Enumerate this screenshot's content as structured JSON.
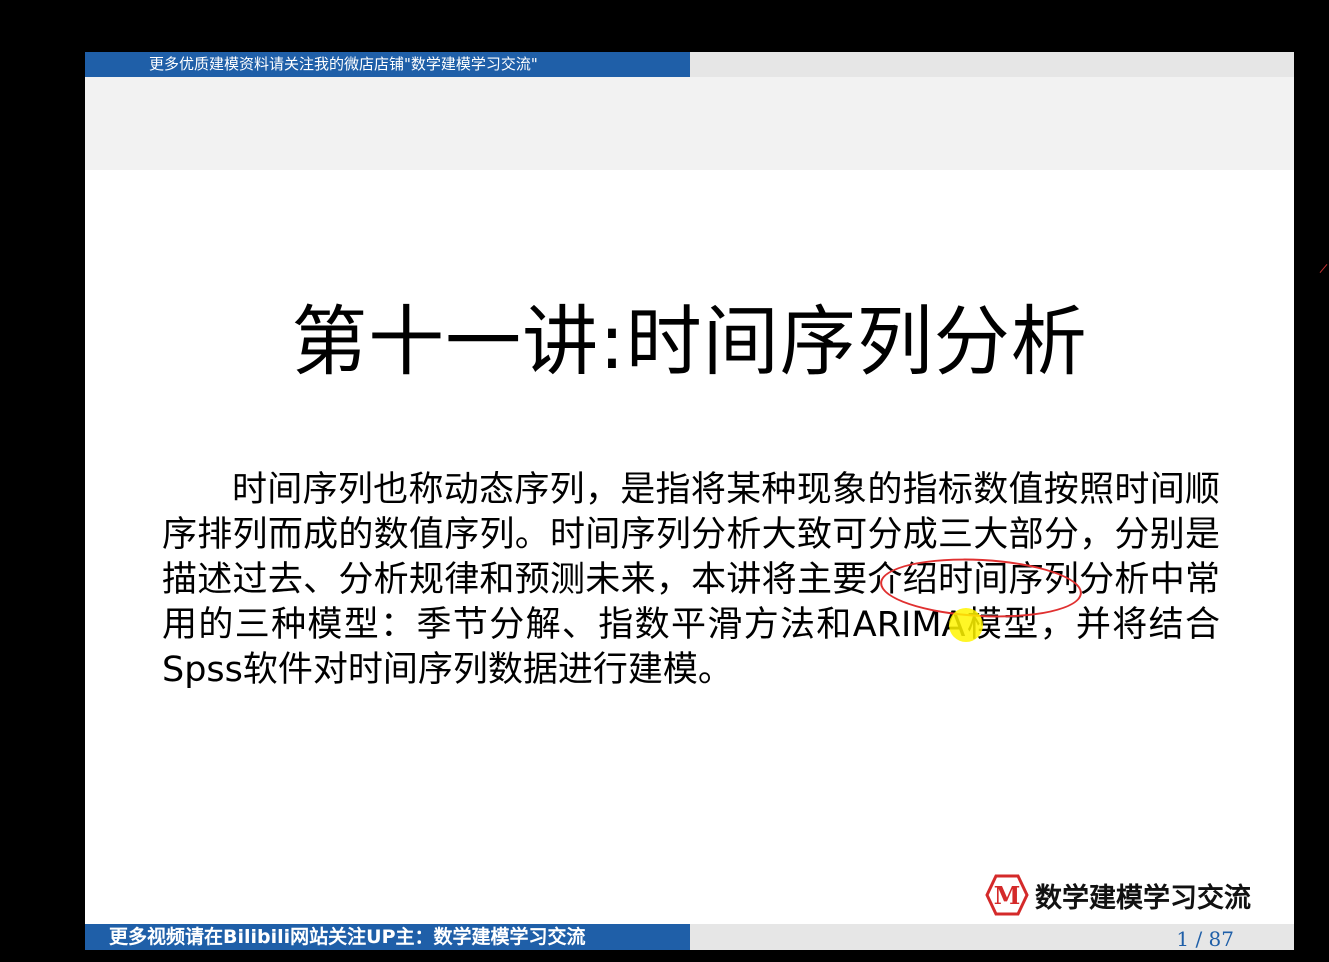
{
  "slide": {
    "top_banner": "更多优质建模资料请关注我的微店店铺\"数学建模学习交流\"",
    "title": "第十一讲:时间序列分析",
    "body": "时间序列也称动态序列，是指将某种现象的指标数值按照时间顺序排列而成的数值序列。时间序列分析大致可分成三大部分，分别是描述过去、分析规律和预测未来，本讲将主要介绍时间序列分析中常用的三种模型：季节分解、指数平滑方法和ARIMA模型，并将结合Spss软件对时间序列数据进行建模。",
    "logo_mark": "M",
    "logo_name": "数学建模学习交流",
    "bottom_banner": "更多视频请在Bilibili网站关注UP主：数学建模学习交流",
    "page_counter": "1 / 87"
  },
  "colors": {
    "banner": "#1f5fa8",
    "annotation": "#e03030",
    "pointer": "#fff500",
    "logo_red": "#d42a2a"
  },
  "icons": {
    "logo": "hexagon-m-logo-icon",
    "pointer": "laser-pointer-icon"
  }
}
